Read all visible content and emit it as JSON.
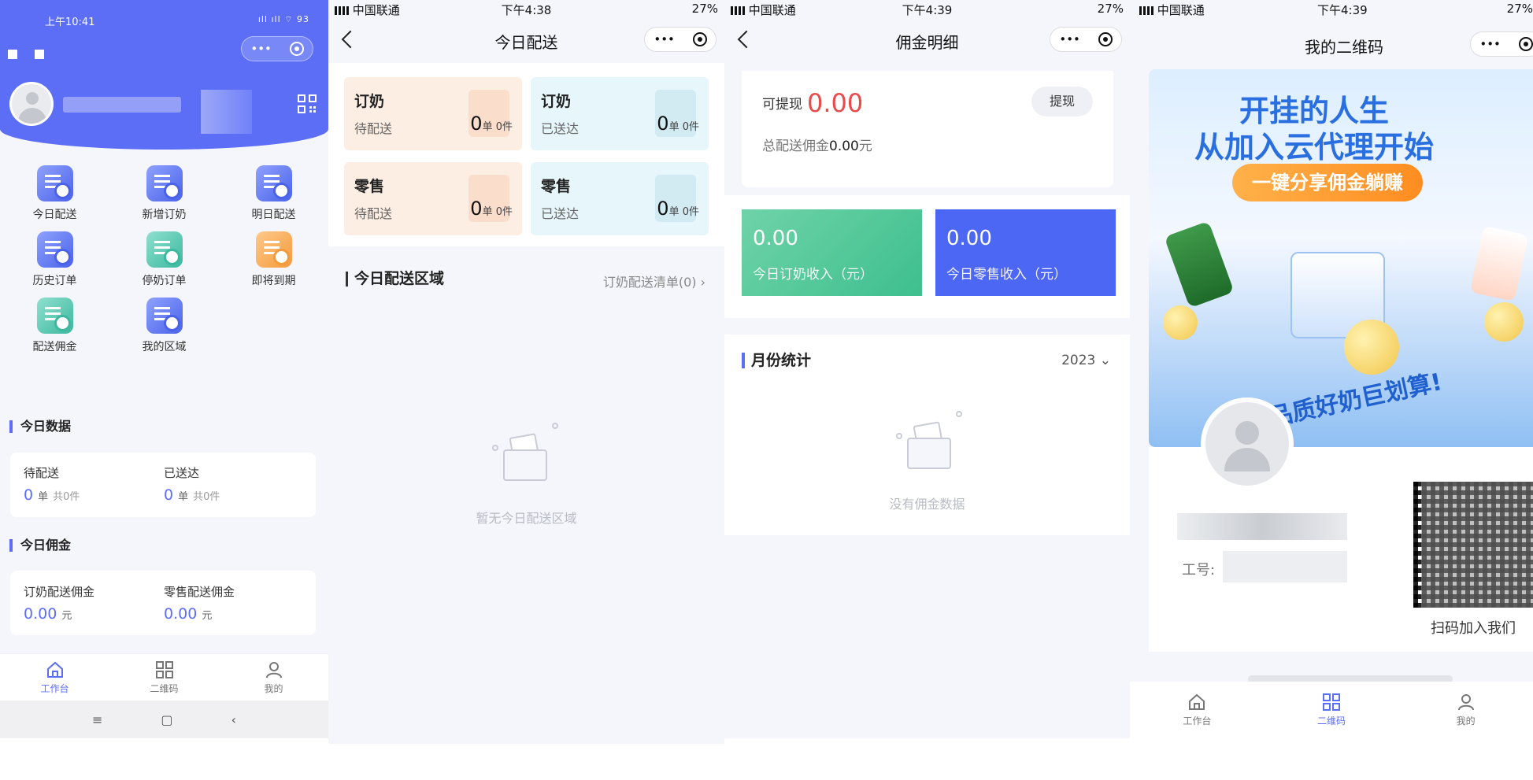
{
  "screen1": {
    "status_time": "上午10:41",
    "status_icons": "ıll ıll ⌔ 93",
    "menu": [
      {
        "label": "今日配送",
        "icon": "delivery-today-icon",
        "tone": "blue"
      },
      {
        "label": "新增订奶",
        "icon": "new-milk-order-icon",
        "tone": "blue"
      },
      {
        "label": "明日配送",
        "icon": "delivery-tomorrow-icon",
        "tone": "blue"
      },
      {
        "label": "历史订单",
        "icon": "history-order-icon",
        "tone": "blue"
      },
      {
        "label": "停奶订单",
        "icon": "paused-milk-order-icon",
        "tone": "green"
      },
      {
        "label": "即将到期",
        "icon": "expiring-soon-icon",
        "tone": "orange"
      },
      {
        "label": "配送佣金",
        "icon": "commission-bag-icon",
        "tone": "green"
      },
      {
        "label": "我的区域",
        "icon": "my-area-location-icon",
        "tone": "blue"
      }
    ],
    "today_data": {
      "title": "今日数据",
      "pending_label": "待配送",
      "pending_count": "0",
      "pending_unit": "单",
      "pending_items": "共0件",
      "delivered_label": "已送达",
      "delivered_count": "0",
      "delivered_unit": "单",
      "delivered_items": "共0件"
    },
    "today_commission": {
      "title": "今日佣金",
      "milk_label": "订奶配送佣金",
      "milk_value": "0.00",
      "milk_unit": "元",
      "retail_label": "零售配送佣金",
      "retail_value": "0.00",
      "retail_unit": "元"
    },
    "tabs": [
      {
        "label": "工作台",
        "icon": "home-icon",
        "active": true
      },
      {
        "label": "二维码",
        "icon": "qrcode-icon",
        "active": false
      },
      {
        "label": "我的",
        "icon": "user-icon",
        "active": false
      }
    ],
    "android_nav": {
      "menu": "≡",
      "home": "▢",
      "back": "‹"
    }
  },
  "screen2": {
    "status_carrier": "中国联通",
    "status_time": "下午4:38",
    "status_battery": "27%",
    "title": "今日配送",
    "cards": [
      {
        "title": "订奶",
        "sub": "待配送",
        "count": "0",
        "unit": "单",
        "items": "0件",
        "tone": "peach"
      },
      {
        "title": "订奶",
        "sub": "已送达",
        "count": "0",
        "unit": "单",
        "items": "0件",
        "tone": "blue"
      },
      {
        "title": "零售",
        "sub": "待配送",
        "count": "0",
        "unit": "单",
        "items": "0件",
        "tone": "peach"
      },
      {
        "title": "零售",
        "sub": "已送达",
        "count": "0",
        "unit": "单",
        "items": "0件",
        "tone": "blue"
      }
    ],
    "section_title": "今日配送区域",
    "list_link": "订奶配送清单(0) ›",
    "empty_text": "暂无今日配送区域"
  },
  "screen3": {
    "status_carrier": "中国联通",
    "status_time": "下午4:39",
    "status_battery": "27%",
    "title": "佣金明细",
    "available_label": "可提现",
    "available_value": "0.00",
    "withdraw_button": "提现",
    "total_label": "总配送佣金",
    "total_value": "0.00",
    "total_unit": "元",
    "income_milk_value": "0.00",
    "income_milk_label": "今日订奶收入（元）",
    "income_retail_value": "0.00",
    "income_retail_label": "今日零售收入（元）",
    "month_title": "月份统计",
    "year": "2023",
    "empty_text": "没有佣金数据"
  },
  "screen4": {
    "status_carrier": "中国联通",
    "status_time": "下午4:39",
    "status_battery": "27%",
    "title": "我的二维码",
    "banner_line1": "开挂的人生",
    "banner_line2": "从加入云代理开始",
    "banner_pill": "一键分享佣金躺赚",
    "banner_ribbon": "品质好奶巨划算!",
    "job_label": "工号:",
    "scan_text": "扫码加入我们",
    "tabs": [
      {
        "label": "工作台",
        "icon": "home-icon",
        "active": false
      },
      {
        "label": "二维码",
        "icon": "qrcode-icon",
        "active": true
      },
      {
        "label": "我的",
        "icon": "user-icon",
        "active": false
      }
    ]
  },
  "colors": {
    "primary": "#5b6ef5",
    "green": "#3ebf8e",
    "red": "#e94a4a",
    "orange": "#ff8d20"
  }
}
